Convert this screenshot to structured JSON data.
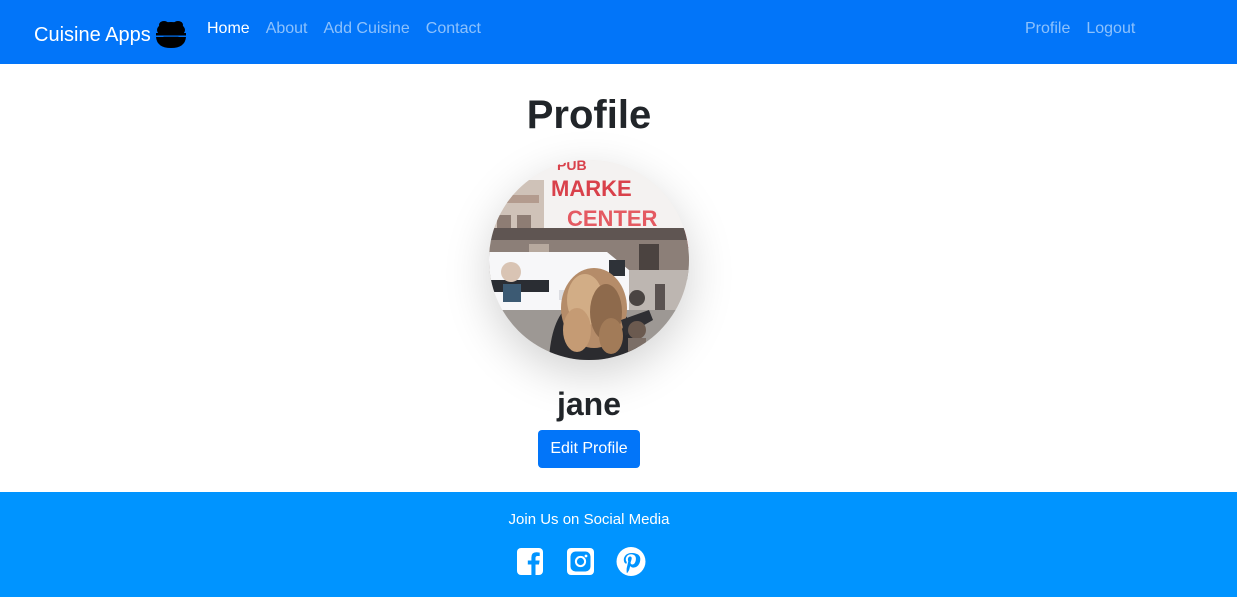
{
  "navbar": {
    "brand": "Cuisine Apps",
    "brand_icon": "bowl-icon",
    "left_links": [
      {
        "label": "Home",
        "active": true
      },
      {
        "label": "About",
        "active": false
      },
      {
        "label": "Add Cuisine",
        "active": false
      },
      {
        "label": "Contact",
        "active": false
      }
    ],
    "right_links": [
      {
        "label": "Profile"
      },
      {
        "label": "Logout"
      }
    ],
    "color": "#0275f9"
  },
  "profile": {
    "title": "Profile",
    "avatar_image": "market-street-photo",
    "username": "jane",
    "edit_button": "Edit Profile"
  },
  "footer": {
    "text": "Join Us on Social Media",
    "icons": [
      "facebook-icon",
      "instagram-icon",
      "pinterest-icon"
    ],
    "color": "#0094ff"
  }
}
